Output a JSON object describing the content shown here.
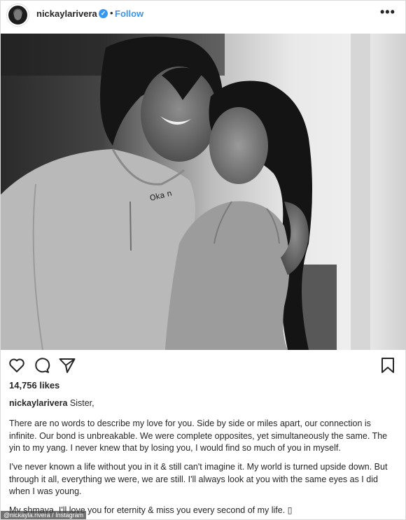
{
  "header": {
    "username": "nickaylarivera",
    "verified_glyph": "✓",
    "separator": "•",
    "follow_label": "Follow",
    "more_label": "•••"
  },
  "photo": {
    "description_icon": "photo",
    "shirt_text": "Oka n"
  },
  "actions": {
    "like_icon": "heart-icon",
    "comment_icon": "comment-icon",
    "share_icon": "share-icon",
    "save_icon": "bookmark-icon"
  },
  "likes": "14,756 likes",
  "caption": {
    "username": "nickaylarivera",
    "lead": "Sister,",
    "paragraph1": "There are no words to describe my love for you. Side by side or miles apart, our connection is infinite. Our bond is unbreakable. We were complete opposites, yet simultaneously the same. The yin to my yang. I never knew that by losing you, I would find so much of you in myself.",
    "paragraph2": "I've never known a life without you in it & still can't imagine it. My world is turned upside down. But through it all, everything we were, we are still. I'll always look at you with the same eyes as I did when I was young.",
    "paragraph3": "My shmaya, I'll love you for eternity & miss you every second of my life. ▯"
  },
  "watermark": "@nickayla.rivera / Instagram",
  "colors": {
    "accent": "#3897f0",
    "text": "#262626",
    "border": "#dbdbdb"
  }
}
